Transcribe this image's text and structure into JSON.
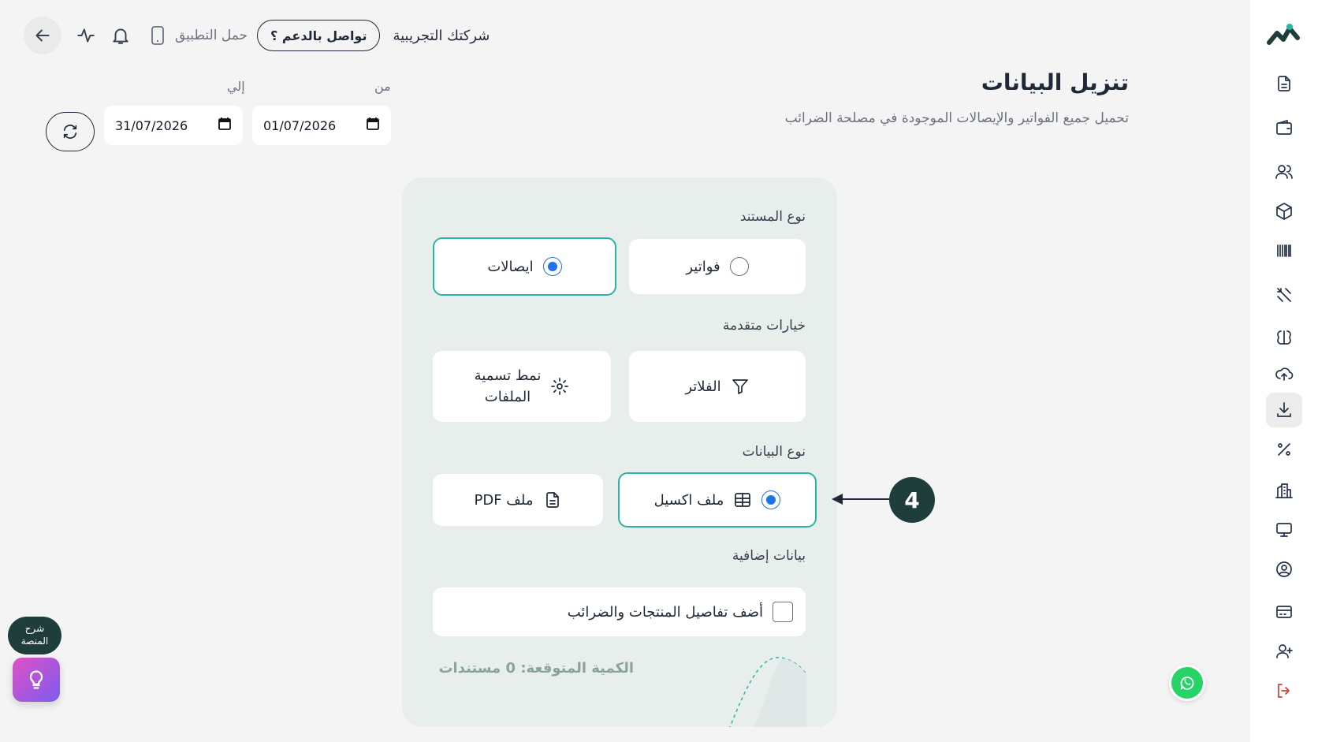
{
  "topbar": {
    "company_name": "شركتك التجريبية",
    "support_label": "تواصل بالدعم ؟",
    "app_download_label": "حمل التطبيق"
  },
  "page": {
    "title": "تنزيل البيانات",
    "subtitle": "تحميل جميع الفواتير والإيصالات الموجودة في مصلحة الضرائب"
  },
  "date_range": {
    "from_label": "من",
    "from_value": "01/07/2026",
    "to_label": "إلي",
    "to_value": "31/07/2026"
  },
  "form": {
    "document_type_label": "نوع المستند",
    "document_types": [
      {
        "label": "ايصالات",
        "selected": true
      },
      {
        "label": "فواتير",
        "selected": false
      }
    ],
    "advanced_label": "خيارات متقدمة",
    "naming_pattern_line1": "نمط تسمية",
    "naming_pattern_line2": "الملفات",
    "filters_label": "الفلاتر",
    "data_type_label": "نوع البيانات",
    "data_types": [
      {
        "label": "ملف PDF",
        "selected": false
      },
      {
        "label": "ملف اكسيل",
        "selected": true
      }
    ],
    "extra_data_label": "بيانات إضافية",
    "extra_checkbox_label": "أضف تفاصيل المنتجات والضرائب",
    "extra_checkbox_checked": false,
    "estimate_text": "الكمية المتوقعة: 0 مستندات"
  },
  "annotation": {
    "number": "4"
  },
  "help": {
    "bubble_line1": "شرح",
    "bubble_line2": "المنصة"
  },
  "colors": {
    "accent": "#2bb4a6",
    "radio_active": "#1d73e8",
    "brand_dark": "#1f3d3a",
    "logout": "#d93a3a"
  }
}
